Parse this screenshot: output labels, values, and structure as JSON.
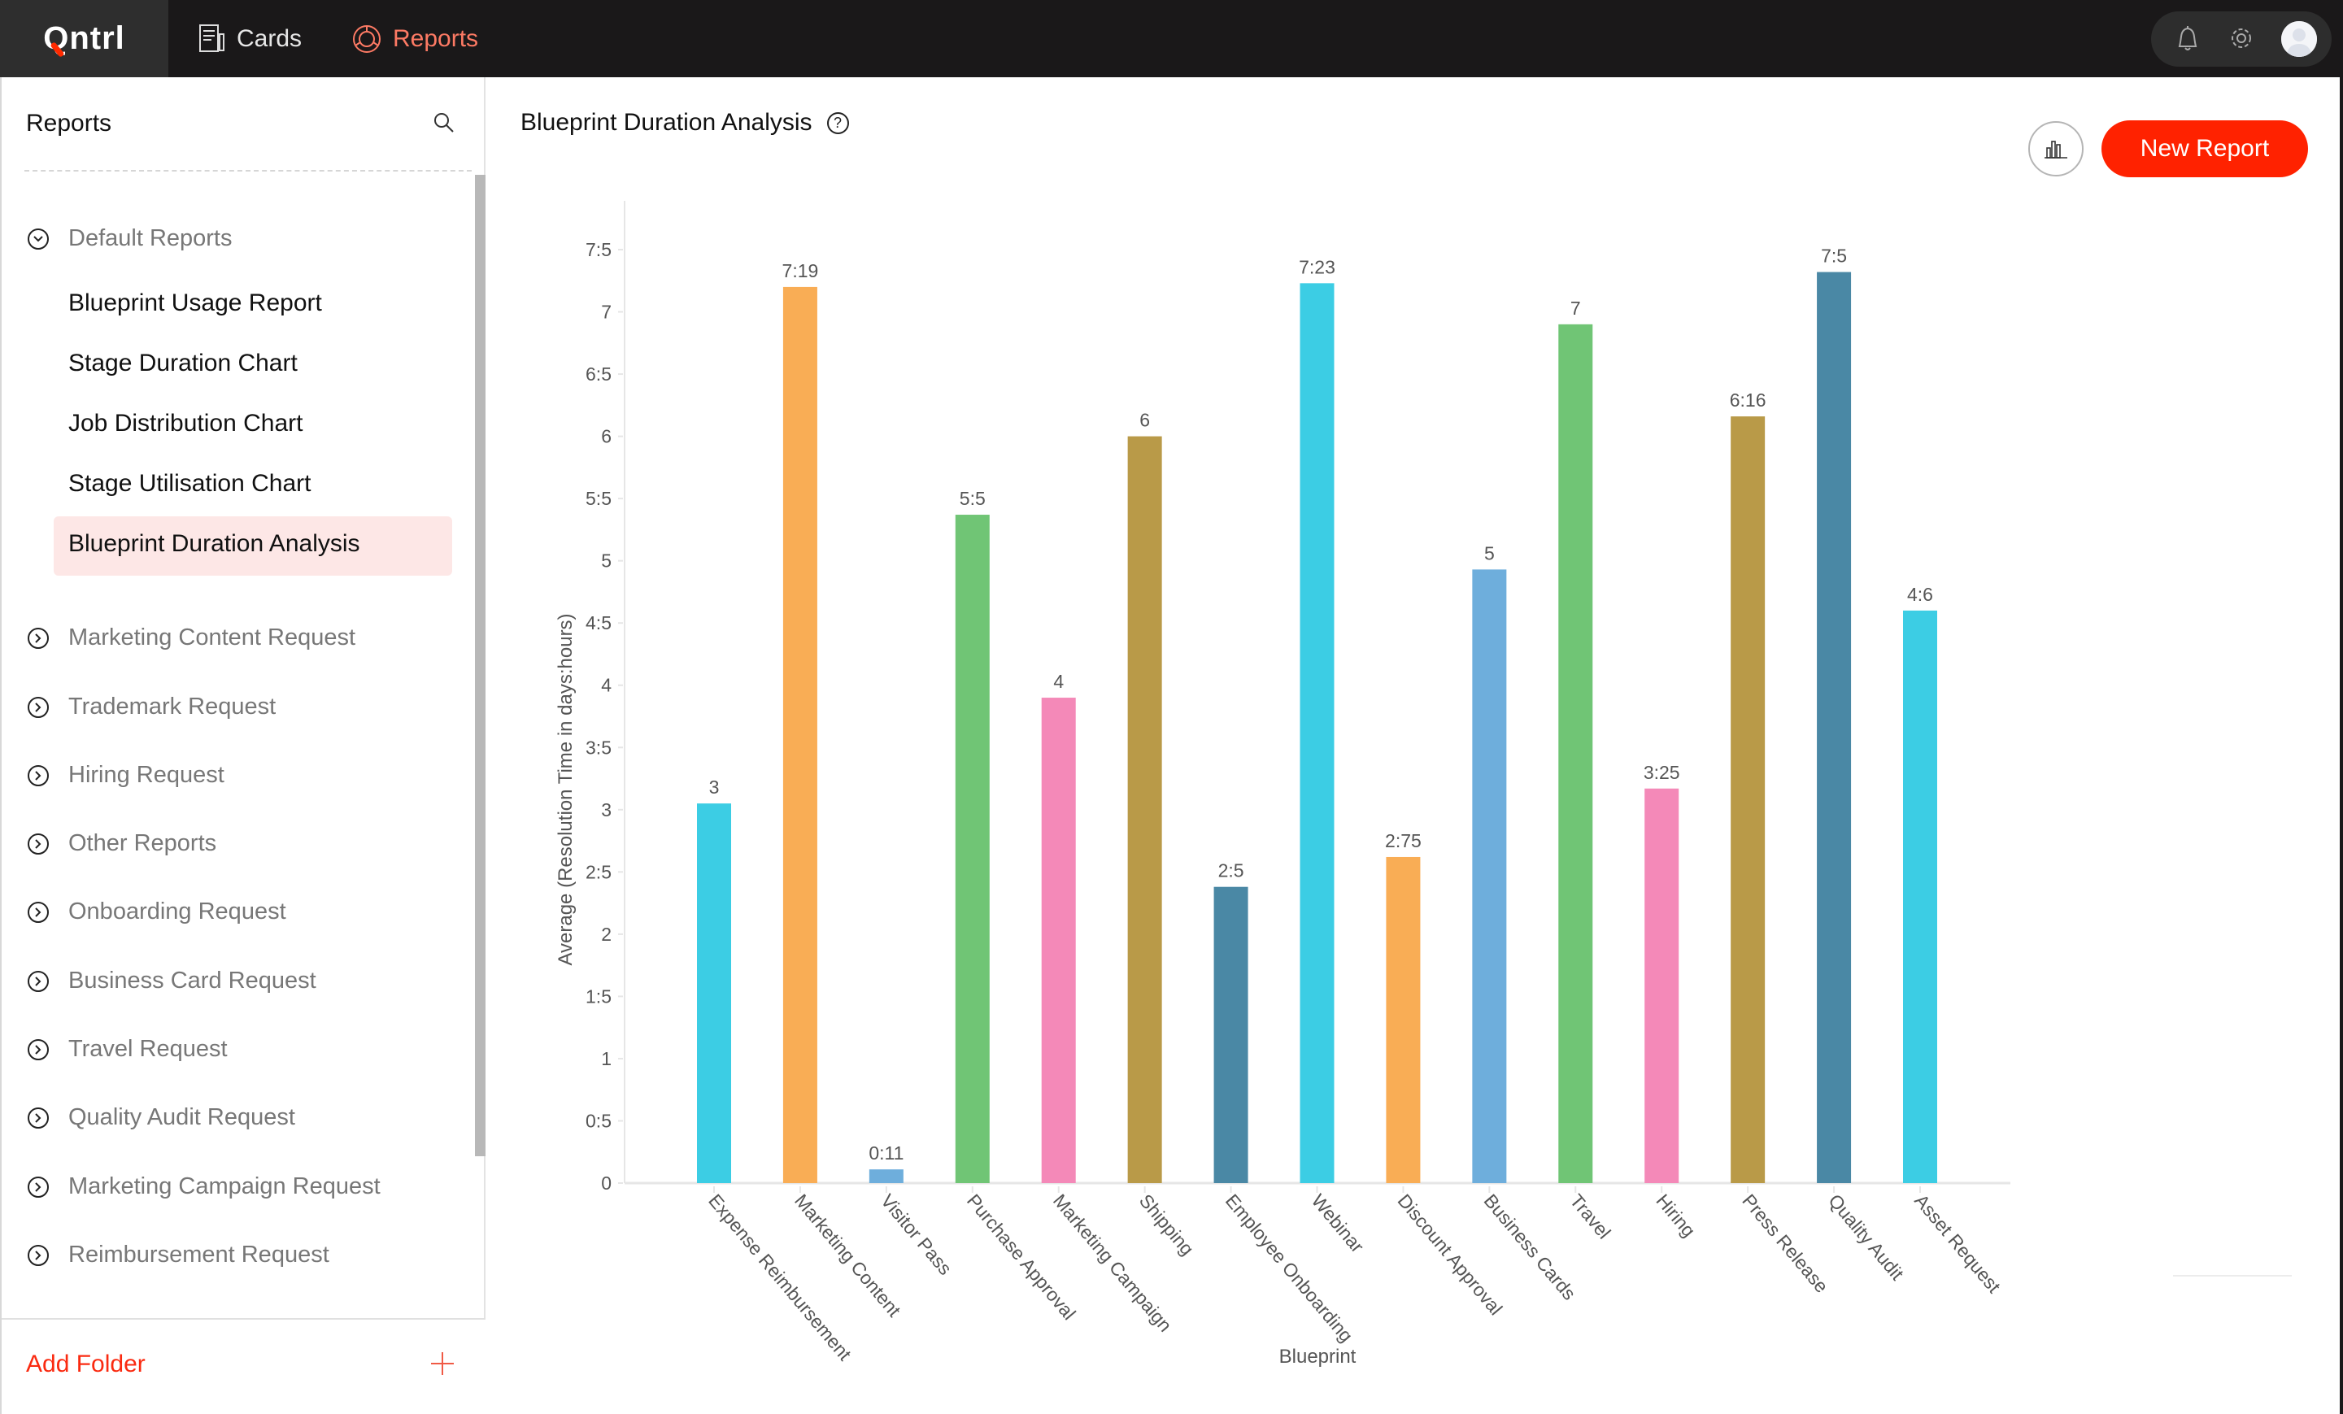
{
  "topbar": {
    "logo": "Qntrl",
    "nav": [
      {
        "label": "Cards",
        "icon": "cards-icon",
        "active": false
      },
      {
        "label": "Reports",
        "icon": "reports-icon",
        "active": true
      }
    ],
    "tray_icons": [
      "bell-icon",
      "gear-icon",
      "avatar"
    ]
  },
  "sidebar": {
    "title": "Reports",
    "default_folder": {
      "label": "Default Reports",
      "expanded": true,
      "items": [
        {
          "label": "Blueprint Usage Report",
          "active": false
        },
        {
          "label": "Stage Duration Chart",
          "active": false
        },
        {
          "label": "Job Distribution Chart",
          "active": false
        },
        {
          "label": "Stage Utilisation Chart",
          "active": false
        },
        {
          "label": "Blueprint Duration Analysis",
          "active": true
        }
      ]
    },
    "folders": [
      "Marketing Content Request",
      "Trademark Request",
      "Hiring Request",
      "Other Reports",
      "Onboarding Request",
      "Business Card Request",
      "Travel Request",
      "Quality Audit Request",
      "Marketing Campaign Request",
      "Reimbursement Request"
    ],
    "add_folder_label": "Add Folder"
  },
  "main": {
    "title": "Blueprint Duration Analysis",
    "help_icon": "?",
    "new_report_label": "New Report",
    "accent": "#ff2200"
  },
  "chart_data": {
    "type": "bar",
    "title": "Blueprint Duration Analysis",
    "xlabel": "Blueprint",
    "ylabel": "Average (Resolution Time in days:hours)",
    "ylim": [
      0,
      7.5
    ],
    "yticks": [
      {
        "value": 0,
        "label": "0"
      },
      {
        "value": 0.5,
        "label": "0:5"
      },
      {
        "value": 1,
        "label": "1"
      },
      {
        "value": 1.5,
        "label": "1:5"
      },
      {
        "value": 2,
        "label": "2"
      },
      {
        "value": 2.5,
        "label": "2:5"
      },
      {
        "value": 3,
        "label": "3"
      },
      {
        "value": 3.5,
        "label": "3:5"
      },
      {
        "value": 4,
        "label": "4"
      },
      {
        "value": 4.5,
        "label": "4:5"
      },
      {
        "value": 5,
        "label": "5"
      },
      {
        "value": 5.5,
        "label": "5:5"
      },
      {
        "value": 6,
        "label": "6"
      },
      {
        "value": 6.5,
        "label": "6:5"
      },
      {
        "value": 7,
        "label": "7"
      },
      {
        "value": 7.5,
        "label": "7:5"
      }
    ],
    "grid": false,
    "legend": "none",
    "categories": [
      "Expense Reimbursement",
      "Marketing Content",
      "Visitor Pass",
      "Purchase Approval",
      "Marketing Campaign",
      "Shipping",
      "Employee Onboarding",
      "Webinar",
      "Discount Approval",
      "Business Cards",
      "Travel",
      "Hiring",
      "Press Release",
      "Quality Audit",
      "Asset Request"
    ],
    "values": [
      3.05,
      7.2,
      0.11,
      5.37,
      3.9,
      6.0,
      2.38,
      7.23,
      2.62,
      4.93,
      6.9,
      3.17,
      6.16,
      7.32,
      4.6
    ],
    "data_labels": [
      "3",
      "7:19",
      "0:11",
      "5:5",
      "4",
      "6",
      "2:5",
      "7:23",
      "2:75",
      "5",
      "7",
      "3:25",
      "6:16",
      "7:5",
      "4:6"
    ],
    "colors": [
      "#3ccde4",
      "#f9ad55",
      "#6eaedc",
      "#70c575",
      "#f489b8",
      "#b99a48",
      "#4a88a5",
      "#3ccde4",
      "#f9ad55",
      "#6eaedc",
      "#70c575",
      "#f489b8",
      "#b99a48",
      "#4a88a5",
      "#3ccde4"
    ]
  }
}
